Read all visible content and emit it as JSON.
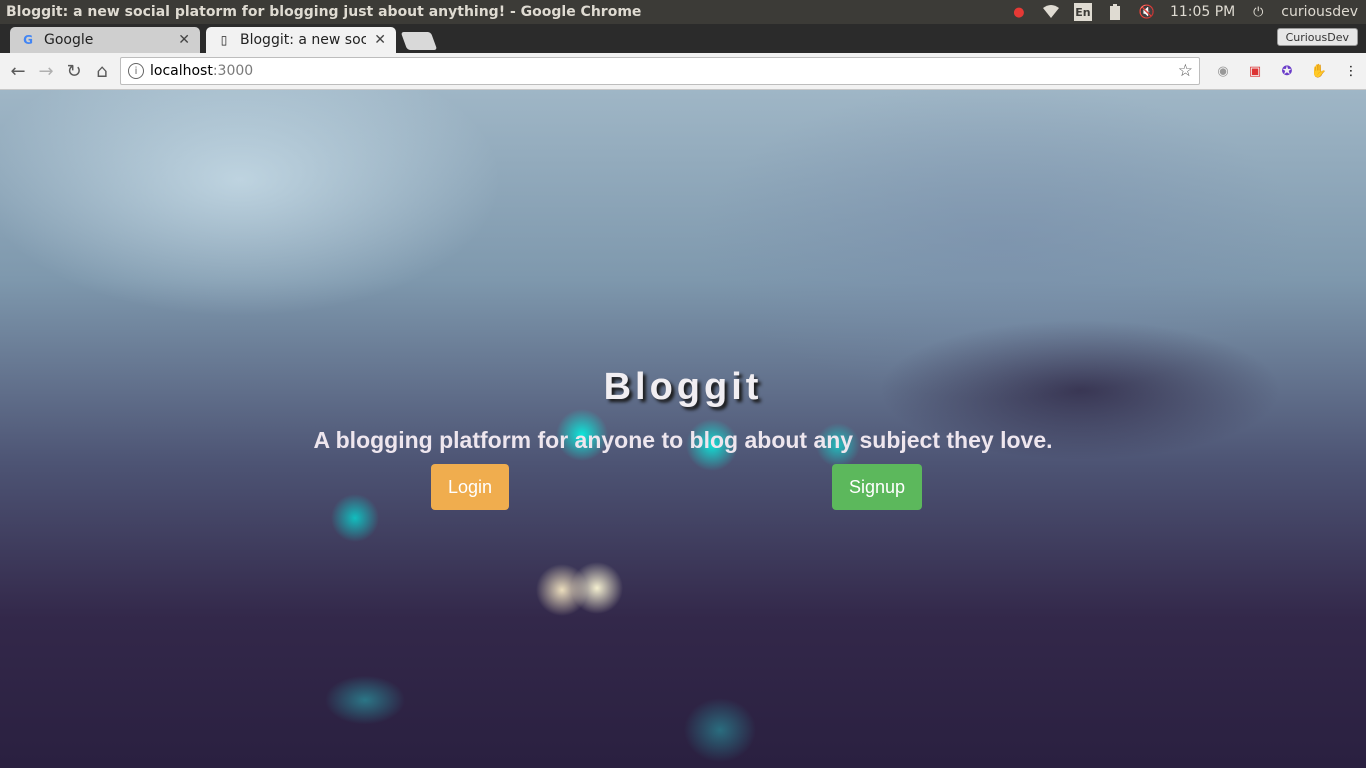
{
  "window": {
    "title": "Bloggit: a new social platorm for blogging just about anything! - Google Chrome"
  },
  "tray": {
    "language": "En",
    "time": "11:05 PM",
    "user": "curiousdev"
  },
  "tabs": [
    {
      "label": "Google",
      "favicon": "G"
    },
    {
      "label": "Bloggit: a new socia"
    }
  ],
  "profile": {
    "label": "CuriousDev"
  },
  "omnibox": {
    "host": "localhost",
    "port": ":3000"
  },
  "hero": {
    "title": "Bloggit",
    "subtitle": "A blogging platform for anyone to blog about any subject they love.",
    "login_label": "Login",
    "signup_label": "Signup"
  },
  "colors": {
    "login": "#f0ad4e",
    "signup": "#5cb85c"
  }
}
